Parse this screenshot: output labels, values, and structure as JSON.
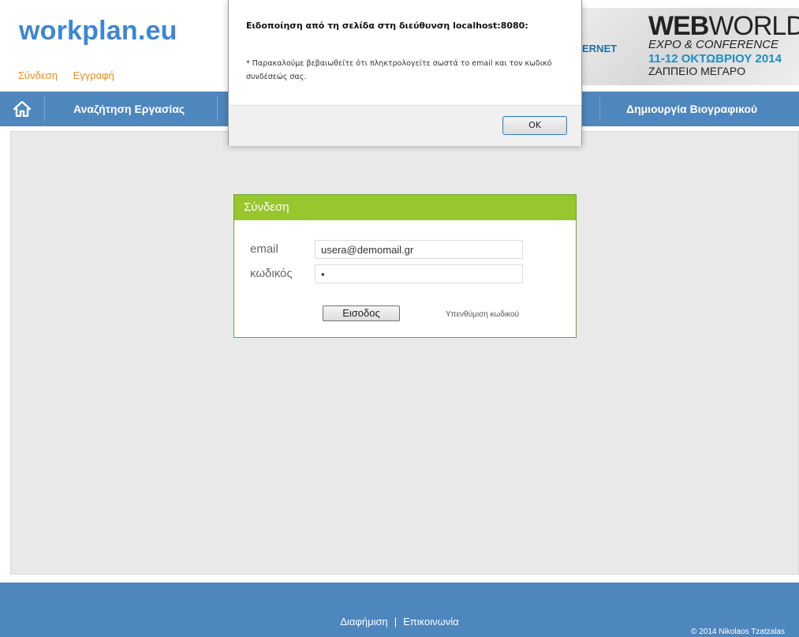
{
  "header": {
    "logo": "workplan.eu",
    "login_link": "Σύνδεση",
    "register_link": "Εγγραφή"
  },
  "banner": {
    "partial_text": "ERNET",
    "title_bold": "WEB",
    "title_thin": "WORLD",
    "subtitle": "EXPO & CONFERENCE",
    "date": "11-12 ΟΚΤΩΒΡΙΟΥ 2014",
    "venue": "ΖΑΠΠΕΙΟ ΜΕΓΑΡΟ"
  },
  "nav": {
    "items": [
      "Αναζήτηση Εργασίας",
      "Δημιουργία Βιογραφικού"
    ]
  },
  "login": {
    "title": "Σύνδεση",
    "email_label": "email",
    "email_value": "usera@demomail.gr",
    "password_label": "κωδικός",
    "password_value": "•",
    "submit_label": "Εισοδος",
    "forgot_link": "Υπενθύμιση κωδικού"
  },
  "dialog": {
    "title": "Ειδοποίηση από τη σελίδα στη διεύθυνση localhost:8080:",
    "message": "* Παρακαλούμε βεβαιωθείτε ότι πληκτρολογείτε σωστά το email και τον κωδικό συνδέσεώς σας.",
    "ok_label": "OK"
  },
  "footer": {
    "ad_link": "Διαφήμιση",
    "separator": "|",
    "contact_link": "Επικοινωνία",
    "copyright": "© 2014 Nikolaos Tzatzalas"
  },
  "colors": {
    "brand_blue": "#3d86d4",
    "nav_blue": "#4e86be",
    "accent_orange": "#f08a1c",
    "login_green": "#97c62d"
  }
}
